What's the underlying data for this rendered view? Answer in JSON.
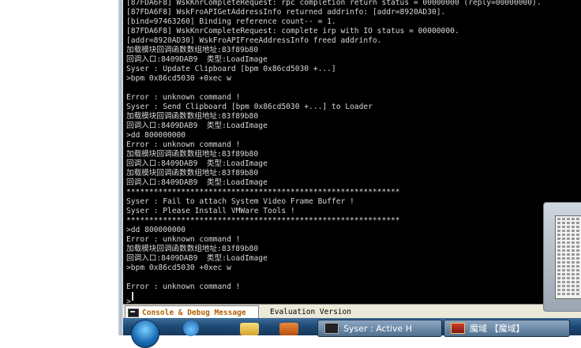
{
  "console": {
    "lines": [
      "[87FDA6F8] WskKnrCompleteRequest: rpc completion return status = 00000000 (reply=00000000).",
      "[87FDA6F8] WskFroAPIGetAddressInfo returned addrinfo: [addr=8920AD30].",
      "[bind=97463260] Binding reference count-- = 1.",
      "[87FDA6F8] WskKnrCompleteRequest: complete irp with IO status = 00000000.",
      "[addr=8920AD30] WskFroAPIFreeAddressInfo freed addrinfo.",
      "加载模块回调函数数组地址:83f89b80",
      "回调入口:8409DAB9  类型:LoadImage",
      "Syser : Update Clipboard [bpm 0x86cd5030 +...]",
      ">bpm 0x86cd5030 +0xec w",
      "",
      "Error : unknown command !",
      "Syser : Send Clipboard [bpm 0x86cd5030 +...] to Loader",
      "加载模块回调函数数组地址:83f89b80",
      "回调入口:8409DAB9  类型:LoadImage",
      ">dd 800000000",
      "Error : unknown command !",
      "加载模块回调函数数组地址:83f89b80",
      "回调入口:8409DAB9  类型:LoadImage",
      "加载模块回调函数数组地址:83f89b80",
      "回调入口:8409DAB9  类型:LoadImage",
      "************************************************************",
      "Syser : Fail to attach System Video Frame Buffer !",
      "Syser : Please Install VMWare Tools !",
      "************************************************************",
      ">dd 800000000",
      "Error : unknown command !",
      "加载模块回调函数数组地址:83f89b80",
      "回调入口:8409DAB9  类型:LoadImage",
      ">bpm 0x86cd5030 +0xec w",
      "",
      "Error : unknown command !"
    ],
    "prompt": ">"
  },
  "tabs": {
    "active_label": "Console & Debug Message",
    "inactive_label": "Evaluation Version"
  },
  "taskbar": {
    "syser_label": "Syser : Active H",
    "mote_label": "魔域 【魔域】"
  }
}
